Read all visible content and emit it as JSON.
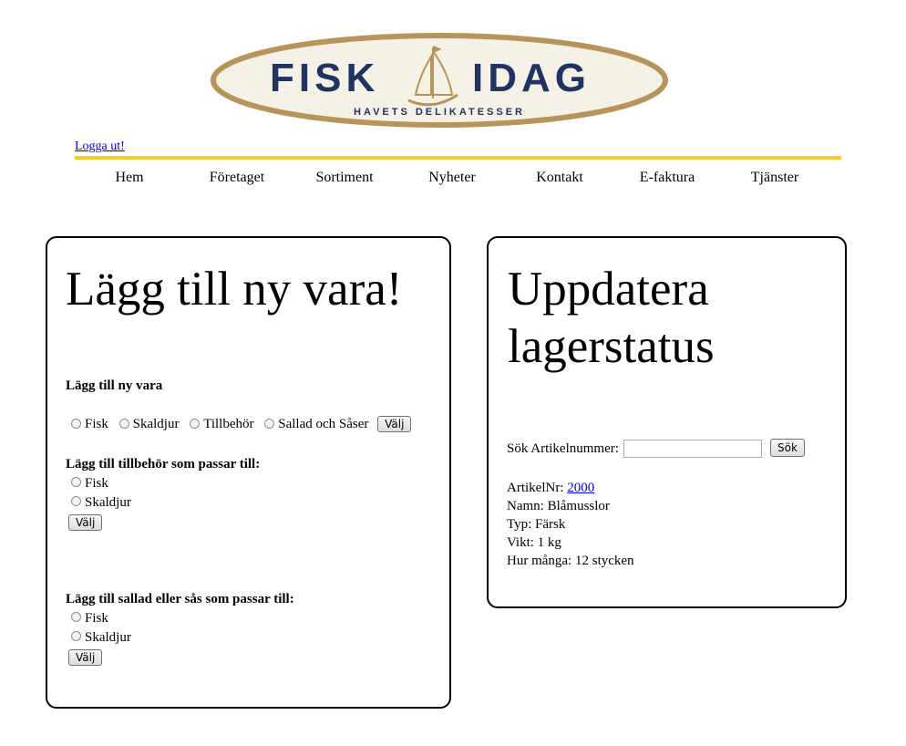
{
  "logo": {
    "wordmark_left": "FISK",
    "wordmark_right": "IDAG",
    "tagline": "HAVETS DELIKATESSER"
  },
  "colors": {
    "accent_rule": "#f2cd2a",
    "logo_gold": "#b7955a",
    "logo_navy": "#1f3461",
    "link": "#0000ee"
  },
  "header": {
    "logout_link": "Logga ut!"
  },
  "nav": {
    "items": [
      "Hem",
      "Företaget",
      "Sortiment",
      "Nyheter",
      "Kontakt",
      "E-faktura",
      "Tjänster"
    ]
  },
  "add_item": {
    "title": "Lägg till ny vara!",
    "section1": {
      "heading": "Lägg till ny vara",
      "options": [
        "Fisk",
        "Skaldjur",
        "Tillbehör",
        "Sallad och Såser"
      ],
      "button": "Välj"
    },
    "section2": {
      "heading": "Lägg till tillbehör som passar till:",
      "options": [
        "Fisk",
        "Skaldjur"
      ],
      "button": "Välj"
    },
    "section3": {
      "heading": "Lägg till sallad eller sås som passar till:",
      "options": [
        "Fisk",
        "Skaldjur"
      ],
      "button": "Välj"
    }
  },
  "stock": {
    "title_line1": "Uppdatera",
    "title_line2": "lagerstatus",
    "search_label": "Sök Artikelnummer:",
    "search_value": "",
    "search_button": "Sök",
    "result": {
      "article_label": "ArtikelNr: ",
      "article_no": "2000",
      "name": "Namn: Blåmusslor",
      "type": "Typ: Färsk",
      "weight": "Vikt: 1 kg",
      "count": "Hur många: 12 stycken"
    }
  }
}
